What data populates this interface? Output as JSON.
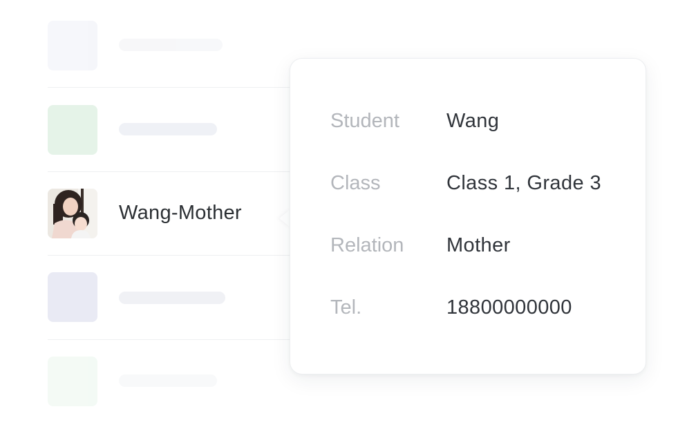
{
  "contact_list": {
    "selected": {
      "name": "Wang-Mother",
      "avatar_icon": "mother-child-photo"
    },
    "placeholder_colors": [
      "#f1f2f8",
      "#e6f3e8",
      "#e8e9f5",
      "#eaf5ec"
    ]
  },
  "popover": {
    "rows": [
      {
        "label": "Student",
        "value": "Wang"
      },
      {
        "label": "Class",
        "value": "Class 1, Grade 3"
      },
      {
        "label": "Relation",
        "value": "Mother"
      },
      {
        "label": "Tel.",
        "value": "18800000000"
      }
    ]
  }
}
